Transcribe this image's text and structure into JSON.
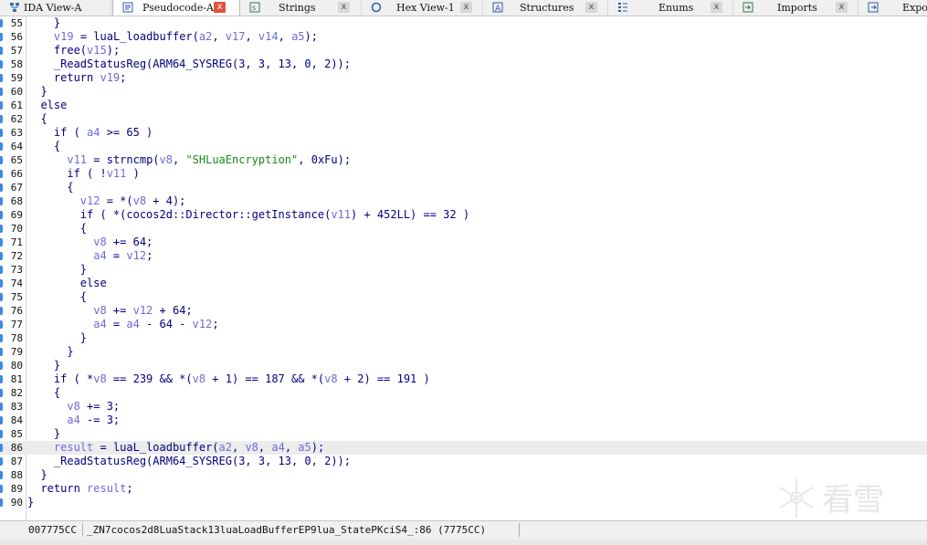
{
  "tabs": [
    {
      "label": "IDA View-A",
      "icon": "graph-icon",
      "active": false
    },
    {
      "label": "Pseudocode-A",
      "icon": "pseudocode-icon",
      "active": true
    },
    {
      "label": "Strings",
      "icon": "strings-icon",
      "active": false
    },
    {
      "label": "Hex View-1",
      "icon": "hex-icon",
      "active": false
    },
    {
      "label": "Structures",
      "icon": "structures-icon",
      "active": false
    },
    {
      "label": "Enums",
      "icon": "enums-icon",
      "active": false
    },
    {
      "label": "Imports",
      "icon": "imports-icon",
      "active": false
    },
    {
      "label": "Expor",
      "icon": "exports-icon",
      "active": false
    }
  ],
  "close_glyph": "x",
  "code": {
    "highlight_line": "86",
    "lines": [
      {
        "n": "55",
        "t": "    }"
      },
      {
        "n": "56",
        "t": "    v19 = luaL_loadbuffer(a2, v17, v14, a5);"
      },
      {
        "n": "57",
        "t": "    free(v15);"
      },
      {
        "n": "58",
        "t": "    _ReadStatusReg(ARM64_SYSREG(3, 3, 13, 0, 2));"
      },
      {
        "n": "59",
        "t": "    return v19;"
      },
      {
        "n": "60",
        "t": "  }"
      },
      {
        "n": "61",
        "t": "  else"
      },
      {
        "n": "62",
        "t": "  {"
      },
      {
        "n": "63",
        "t": "    if ( a4 >= 65 )"
      },
      {
        "n": "64",
        "t": "    {"
      },
      {
        "n": "65",
        "t": "      v11 = strncmp(v8, \"SHLuaEncryption\", 0xFu);"
      },
      {
        "n": "66",
        "t": "      if ( !v11 )"
      },
      {
        "n": "67",
        "t": "      {"
      },
      {
        "n": "68",
        "t": "        v12 = *(v8 + 4);"
      },
      {
        "n": "69",
        "t": "        if ( *(cocos2d::Director::getInstance(v11) + 452LL) == 32 )"
      },
      {
        "n": "70",
        "t": "        {"
      },
      {
        "n": "71",
        "t": "          v8 += 64;"
      },
      {
        "n": "72",
        "t": "          a4 = v12;"
      },
      {
        "n": "73",
        "t": "        }"
      },
      {
        "n": "74",
        "t": "        else"
      },
      {
        "n": "75",
        "t": "        {"
      },
      {
        "n": "76",
        "t": "          v8 += v12 + 64;"
      },
      {
        "n": "77",
        "t": "          a4 = a4 - 64 - v12;"
      },
      {
        "n": "78",
        "t": "        }"
      },
      {
        "n": "79",
        "t": "      }"
      },
      {
        "n": "80",
        "t": "    }"
      },
      {
        "n": "81",
        "t": "    if ( *v8 == 239 && *(v8 + 1) == 187 && *(v8 + 2) == 191 )"
      },
      {
        "n": "82",
        "t": "    {"
      },
      {
        "n": "83",
        "t": "      v8 += 3;"
      },
      {
        "n": "84",
        "t": "      a4 -= 3;"
      },
      {
        "n": "85",
        "t": "    }"
      },
      {
        "n": "86",
        "t": "    result = luaL_loadbuffer(a2, v8, a4, a5);"
      },
      {
        "n": "87",
        "t": "    _ReadStatusReg(ARM64_SYSREG(3, 3, 13, 0, 2));"
      },
      {
        "n": "88",
        "t": "  }"
      },
      {
        "n": "89",
        "t": "  return result;"
      },
      {
        "n": "90",
        "t": "}"
      }
    ],
    "variables": [
      "v19",
      "v17",
      "v14",
      "v15",
      "v11",
      "v12",
      "v8",
      "a2",
      "a4",
      "a5",
      "result"
    ]
  },
  "status": {
    "address": "007775CC",
    "location": "_ZN7cocos2d8LuaStack13luaLoadBufferEP9lua_StatePKciS4_:86 (7775CC)"
  },
  "watermark": {
    "text": "看雪"
  },
  "colors": {
    "keyword": "#000080",
    "variable": "#6b6bd9",
    "string": "#148c14",
    "breakpoint": "#3c8ae6",
    "active_close": "#e0533e"
  }
}
